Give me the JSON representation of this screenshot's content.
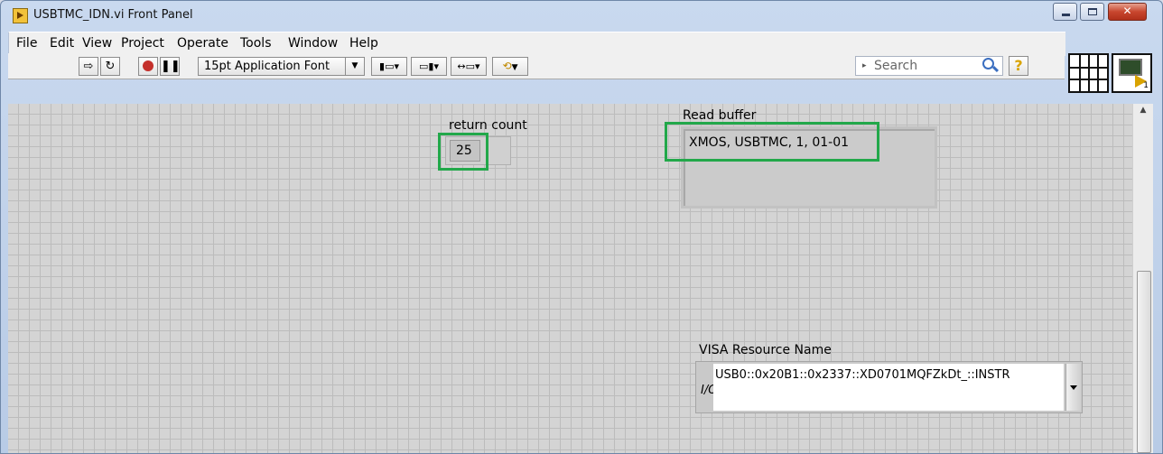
{
  "window": {
    "title": "USBTMC_IDN.vi Front Panel"
  },
  "menu": [
    "File",
    "Edit",
    "View",
    "Project",
    "Operate",
    "Tools",
    "Window",
    "Help"
  ],
  "toolbar": {
    "font_label": "15pt Application Font",
    "search_placeholder": "Search",
    "help_label": "?"
  },
  "vi_icon": {
    "number": "1"
  },
  "panel": {
    "return_count": {
      "label": "return count",
      "value": "25"
    },
    "read_buffer": {
      "label": "Read buffer",
      "value": "XMOS, USBTMC, 1, 01-01"
    },
    "visa": {
      "label": "VISA Resource Name",
      "io_glyph": "I/O",
      "value": "USB0::0x20B1::0x2337::XD0701MQFZkDt_::INSTR"
    }
  },
  "colors": {
    "highlight": "#22a84a",
    "panel_grid": "#bcbcbc"
  }
}
